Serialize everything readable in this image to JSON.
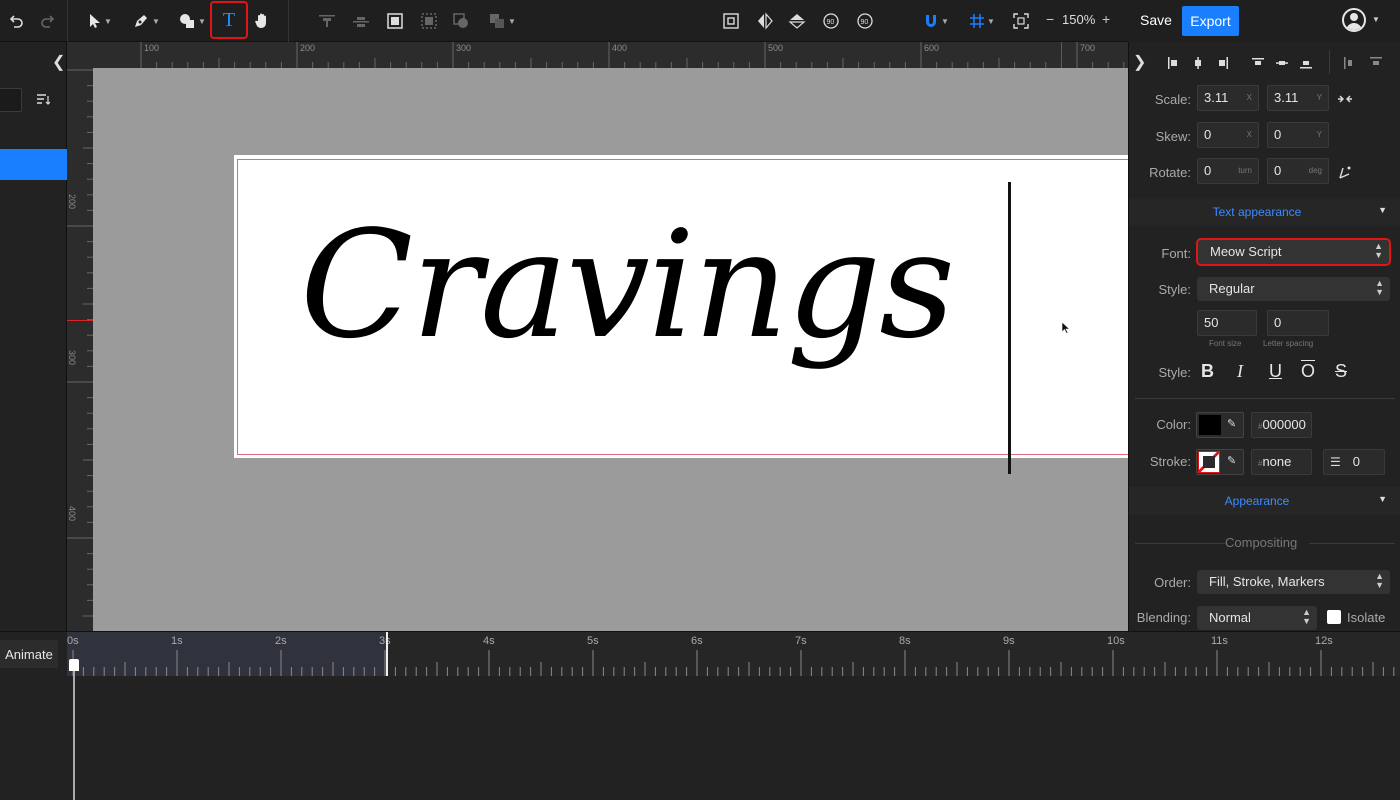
{
  "toolbar": {
    "zoom": "150%",
    "zoom_minus": "−",
    "zoom_plus": "+",
    "text_tool_glyph": "T"
  },
  "header": {
    "save_label": "Save",
    "export_label": "Export"
  },
  "rulers": {
    "top_ticks": [
      "100",
      "200",
      "300",
      "400",
      "500",
      "600",
      "700"
    ],
    "left_ticks": [
      "200",
      "300",
      "400"
    ]
  },
  "canvas": {
    "text": "Cravings"
  },
  "props": {
    "scale_label": "Scale:",
    "scale_x": "3.11",
    "scale_y": "3.11",
    "scale_x_unit": "X",
    "scale_y_unit": "Y",
    "skew_label": "Skew:",
    "skew_x": "0",
    "skew_y": "0",
    "skew_x_unit": "X",
    "skew_y_unit": "Y",
    "rotate_label": "Rotate:",
    "rotate_turn": "0",
    "rotate_turn_unit": "turn",
    "rotate_deg": "0",
    "rotate_deg_unit": "deg",
    "text_appearance_title": "Text appearance",
    "font_label": "Font:",
    "font_value": "Meow Script",
    "style_label": "Style:",
    "style_value": "Regular",
    "font_size": "50",
    "font_size_hint": "Font size",
    "letter_spacing": "0",
    "letter_spacing_hint": "Letter spacing",
    "style2_label": "Style:",
    "style_bold": "B",
    "style_italic": "I",
    "style_underline": "U",
    "style_overline": "O",
    "style_strike": "S",
    "color_label": "Color:",
    "color_value": "000000",
    "hash": "#",
    "stroke_label": "Stroke:",
    "stroke_value": "none",
    "stroke_width": "0",
    "appearance_title": "Appearance",
    "compositing_title": "Compositing",
    "order_label": "Order:",
    "order_value": "Fill, Stroke, Markers",
    "blending_label": "Blending:",
    "blending_value": "Normal",
    "isolate_label": "Isolate"
  },
  "timeline": {
    "animate_label": "Animate",
    "labels": [
      "0s",
      "1s",
      "2s",
      "3s",
      "4s",
      "5s",
      "6s",
      "7s",
      "8s",
      "9s",
      "10s",
      "11s",
      "12s"
    ]
  },
  "colors": {
    "accent": "#1a7fff",
    "highlight": "#e01515",
    "fill_color": "#000000"
  }
}
